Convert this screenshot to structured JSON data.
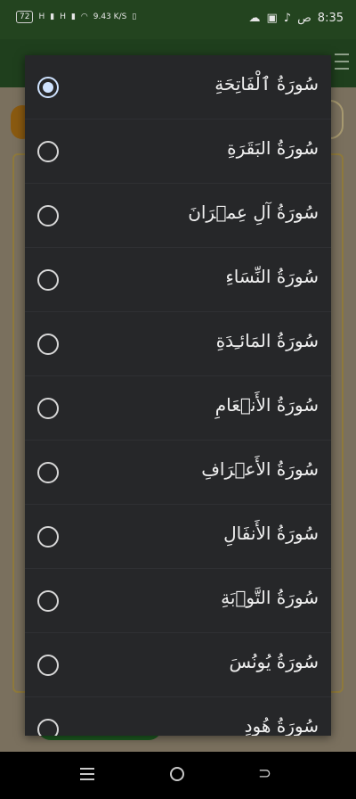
{
  "status_bar": {
    "battery": "72",
    "network_1": "H",
    "network_2": "H",
    "data_speed": "9.43 K/S",
    "time": "8:35",
    "ampm": "ص"
  },
  "dialog": {
    "selected_index": 0,
    "options": [
      {
        "label": "سُورَةُ ٱلْفَاتِحَةِ",
        "checked": true
      },
      {
        "label": "سُورَةُ البَقَرَةِ",
        "checked": false
      },
      {
        "label": "سُورَةُ آلِ عِمۡرَانَ",
        "checked": false
      },
      {
        "label": "سُورَةُ النِّسَاءِ",
        "checked": false
      },
      {
        "label": "سُورَةُ المَائـِدَةِ",
        "checked": false
      },
      {
        "label": "سُورَةُ الأَنۡعَامِ",
        "checked": false
      },
      {
        "label": "سُورَةُ الأَعۡرَافِ",
        "checked": false
      },
      {
        "label": "سُورَةُ الأَنفَالِ",
        "checked": false
      },
      {
        "label": "سُورَةُ التَّوۡبَةِ",
        "checked": false
      },
      {
        "label": "سُورَةُ يُونُسَ",
        "checked": false
      },
      {
        "label": "سُورَةُ هُودٍ",
        "checked": false
      }
    ]
  }
}
